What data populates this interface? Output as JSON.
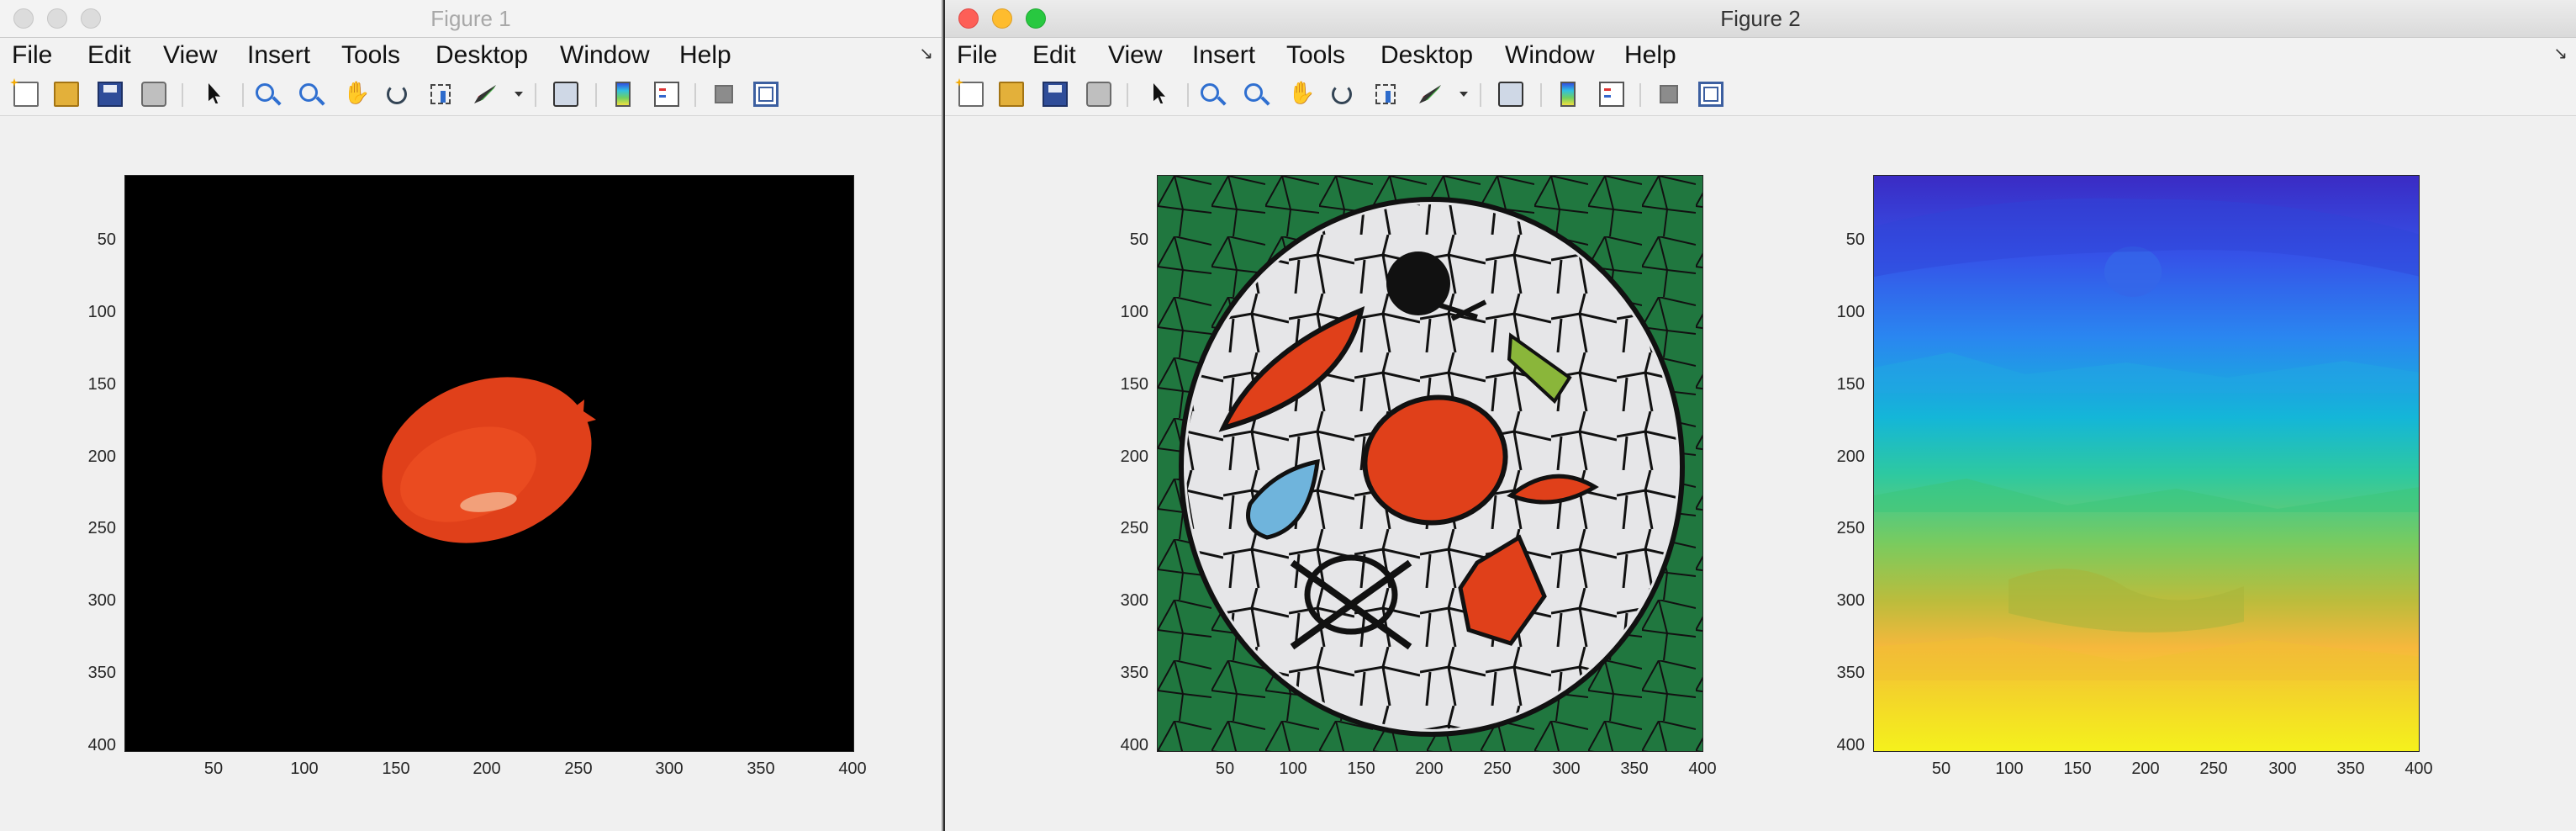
{
  "menu_items": [
    "File",
    "Edit",
    "View",
    "Insert",
    "Tools",
    "Desktop",
    "Window",
    "Help"
  ],
  "toolbar_icons": [
    "new-figure-icon",
    "open-file-icon",
    "save-icon",
    "print-icon",
    "edit-plot-arrow-icon",
    "zoom-in-icon",
    "zoom-out-icon",
    "pan-icon",
    "rotate-3d-icon",
    "data-cursor-icon",
    "brush-icon",
    "link-plot-icon",
    "colorbar-icon",
    "legend-icon",
    "hide-plot-tools-icon",
    "show-plot-tools-icon"
  ],
  "figure1": {
    "title": "Figure 1",
    "active": false,
    "axes": {
      "xlim": [
        0.5,
        400.5
      ],
      "ylim": [
        0.5,
        400.5
      ],
      "yticks": [
        "50",
        "100",
        "150",
        "200",
        "250",
        "300",
        "350",
        "400"
      ],
      "xticks": [
        "50",
        "100",
        "150",
        "200",
        "250",
        "300",
        "350",
        "400"
      ],
      "image": "masked-red-balloon-on-black"
    }
  },
  "figure2": {
    "title": "Figure 2",
    "active": true,
    "left_axes": {
      "xlim": [
        0.5,
        400.5
      ],
      "ylim": [
        0.5,
        400.5
      ],
      "yticks": [
        "50",
        "100",
        "150",
        "200",
        "250",
        "300",
        "350",
        "400"
      ],
      "xticks": [
        "50",
        "100",
        "150",
        "200",
        "250",
        "300",
        "350",
        "400"
      ],
      "image": "superpixel-boundaries-overlay"
    },
    "right_axes": {
      "xlim": [
        0.5,
        400.5
      ],
      "ylim": [
        0.5,
        400.5
      ],
      "yticks": [
        "50",
        "100",
        "150",
        "200",
        "250",
        "300",
        "350",
        "400"
      ],
      "xticks": [
        "50",
        "100",
        "150",
        "200",
        "250",
        "300",
        "350",
        "400"
      ],
      "image": "superpixel-label-map-parula"
    }
  },
  "colors": {
    "figure_bg": "#f0f0f0",
    "green_background": "#20773f",
    "balloon_red": "#e0401a",
    "parula_top": "#3a2bc4",
    "parula_bottom": "#f5f11c"
  }
}
